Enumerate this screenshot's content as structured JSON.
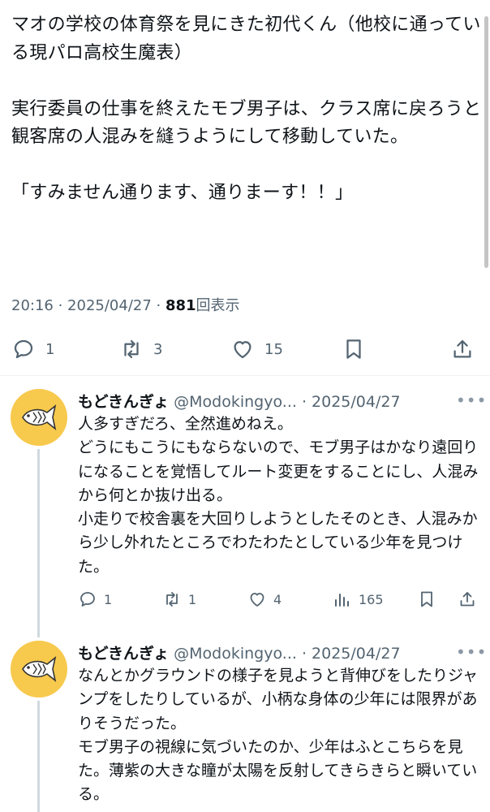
{
  "main_tweet": {
    "text": "マオの学校の体育祭を見にきた初代くん（他校に通っている現パロ高校生魔表）\n\n実行委員の仕事を終えたモブ男子は、クラス席に戻ろうと観客席の人混みを縫うようにして移動していた。\n\n「すみません通ります、通りまーす！！」",
    "time": "20:16 · 2025/04/27 · ",
    "views_count": "881",
    "views_label": "回表示",
    "replies": "1",
    "retweets": "3",
    "likes": "15"
  },
  "replies": [
    {
      "name": "もどきんぎょ",
      "handle": "@Modokingyo...",
      "date": "· 2025/04/27",
      "more": "•••",
      "text": "人多すぎだろ、全然進めねえ。\nどうにもこうにもならないので、モブ男子はかなり遠回りになることを覚悟してルート変更をすることにし、人混みから何とか抜け出る。\n小走りで校舎裏を大回りしようとしたそのとき、人混みから少し外れたところでわたわたとしている少年を見つけた。",
      "replies": "1",
      "retweets": "1",
      "likes": "4",
      "views": "165"
    },
    {
      "name": "もどきんぎょ",
      "handle": "@Modokingyo...",
      "date": "· 2025/04/27",
      "more": "•••",
      "text": "なんとかグラウンドの様子を見ようと背伸びをしたりジャンプをしたりしているが、小柄な身体の少年には限界がありそうだった。\nモブ男子の視線に気づいたのか、少年はふとこちらを見た。薄紫の大きな瞳が太陽を反射してきらきらと瞬いている。"
    }
  ]
}
